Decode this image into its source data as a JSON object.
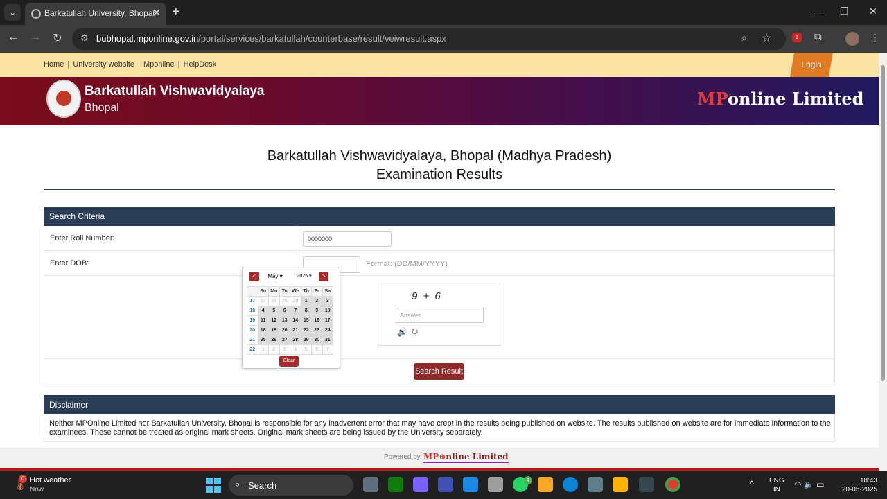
{
  "browser": {
    "tab_title": "Barkatullah University, Bhopal",
    "url_host": "bubhopal.mponline.gov.in",
    "url_path": "/portal/services/barkatullah/counterbase/result/veiwresult.aspx",
    "extension_badge": "1"
  },
  "topbar": {
    "links": [
      "Home",
      "University website",
      "Mponline",
      "HelpDesk"
    ],
    "separator": "|",
    "login_label": "Login"
  },
  "banner": {
    "university_name": "Barkatullah Vishwavidyalaya",
    "university_city": "Bhopal",
    "mp_logo_prefix": "MP",
    "mp_logo_suffix": "online Limited"
  },
  "page": {
    "heading1": "Barkatullah Vishwavidyalaya, Bhopal (Madhya Pradesh)",
    "heading2": "Examination Results"
  },
  "search": {
    "section_title": "Search Criteria",
    "roll_label": "Enter Roll Number:",
    "roll_value": "0000000",
    "dob_label": "Enter DOB:",
    "dob_value": "",
    "dob_format": "Format: (DD/MM/YYYY)",
    "captcha_expression": "9 + 6",
    "captcha_placeholder": "Answer",
    "submit_label": "Search Result"
  },
  "datepicker": {
    "prev_label": "<",
    "next_label": ">",
    "month": "May",
    "year": "2025",
    "weekday_headers": [
      "Su",
      "Mo",
      "Tu",
      "We",
      "Th",
      "Fr",
      "Sa"
    ],
    "weeks": [
      {
        "week": "17",
        "days": [
          "27",
          "28",
          "29",
          "30",
          "1",
          "2",
          "3"
        ]
      },
      {
        "week": "18",
        "days": [
          "4",
          "5",
          "6",
          "7",
          "8",
          "9",
          "10"
        ]
      },
      {
        "week": "19",
        "days": [
          "11",
          "12",
          "13",
          "14",
          "15",
          "16",
          "17"
        ]
      },
      {
        "week": "20",
        "days": [
          "18",
          "19",
          "20",
          "21",
          "22",
          "23",
          "24"
        ]
      },
      {
        "week": "21",
        "days": [
          "25",
          "26",
          "27",
          "28",
          "29",
          "30",
          "31"
        ]
      },
      {
        "week": "22",
        "days": [
          "1",
          "2",
          "3",
          "4",
          "5",
          "6",
          "7"
        ]
      }
    ],
    "clear_label": "Clear"
  },
  "disclaimer": {
    "title": "Disclaimer",
    "text": "Neither MPOnline Limited nor Barkatullah University, Bhopal is responsible for any inadvertent error that may have crept in the results being published on website. The results published on website are for immediate information to the examinees. These cannot be treated as original mark sheets. Original mark sheets are being issued by the University separately."
  },
  "footer": {
    "powered_by": "Powered by",
    "logo_prefix": "MP",
    "logo_suffix": "nline Limited"
  },
  "taskbar": {
    "weather_title": "Hot weather",
    "weather_sub": "Now",
    "weather_badge": "6",
    "search_label": "Search",
    "whatsapp_badge": "4",
    "lang_line1": "ENG",
    "lang_line2": "IN",
    "time": "18:43",
    "date": "20-05-2025"
  },
  "colors": {
    "topbar": "#fbe3a4",
    "section_header": "#2c3e55",
    "button_red": "#8e2a2a",
    "login_orange": "#e07b22"
  }
}
